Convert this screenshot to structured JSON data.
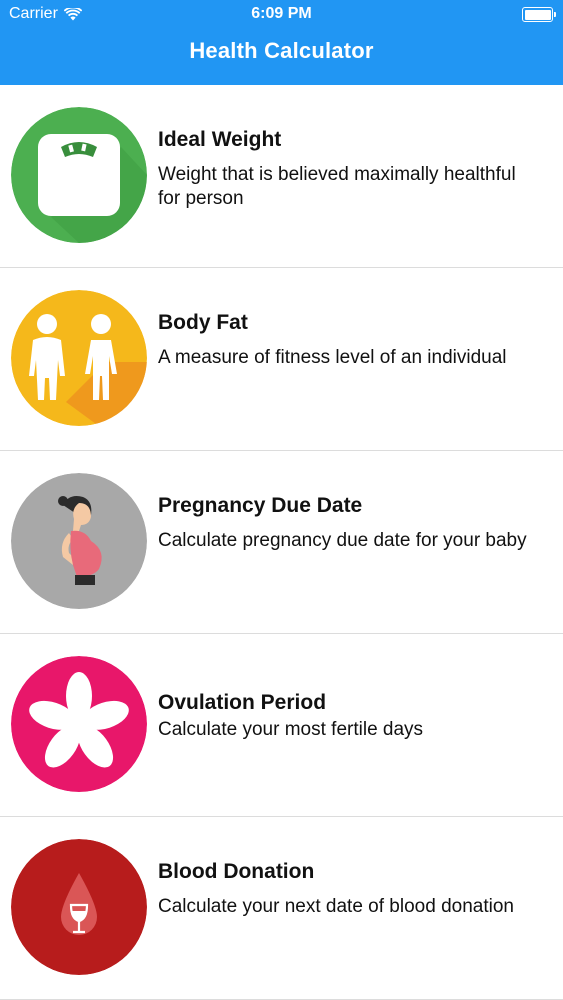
{
  "status_bar": {
    "carrier": "Carrier",
    "time": "6:09 PM",
    "wifi_icon": "wifi-icon",
    "battery_icon": "battery-icon"
  },
  "app_bar": {
    "title": "Health Calculator",
    "color": "#2196f3"
  },
  "items": [
    {
      "title": "Ideal Weight",
      "description": "Weight that is believed maximally healthful for person",
      "icon": "scale-icon",
      "color": "#4caf50"
    },
    {
      "title": "Body Fat",
      "description": "A measure of fitness level of an individual",
      "icon": "body-figures-icon",
      "color": "#f5b81b"
    },
    {
      "title": "Pregnancy Due Date",
      "description": "Calculate pregnancy due date for your baby",
      "icon": "pregnant-woman-icon",
      "color": "#a8a8a8"
    },
    {
      "title": "Ovulation Period",
      "description": "Calculate your most fertile days",
      "icon": "flower-icon",
      "color": "#e8176a"
    },
    {
      "title": "Blood Donation",
      "description": "Calculate your next date of blood donation",
      "icon": "blood-drop-icon",
      "color": "#b71c1c"
    }
  ]
}
